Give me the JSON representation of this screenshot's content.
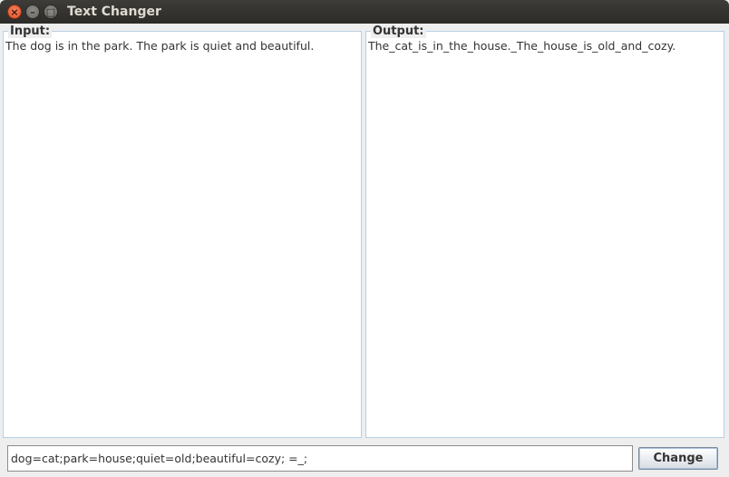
{
  "window": {
    "title": "Text Changer",
    "controls": {
      "close_icon": "×",
      "minimize_icon": "–",
      "maximize_icon": "□"
    }
  },
  "input_panel": {
    "label": "Input:",
    "text": "The dog is in the park. The park is quiet and beautiful."
  },
  "output_panel": {
    "label": "Output:",
    "text": "The_cat_is_in_the_house._The_house_is_old_and_cozy."
  },
  "rules_field": {
    "value": "dog=cat;park=house;quiet=old;beautiful=cozy; =_;"
  },
  "change_button": {
    "label": "Change"
  }
}
